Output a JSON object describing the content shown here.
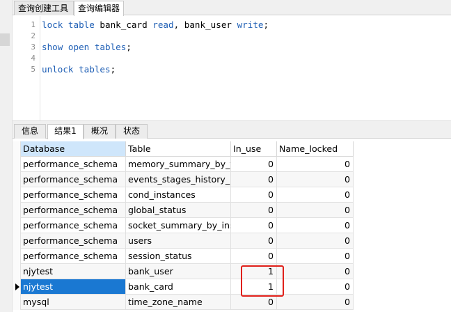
{
  "top_tabs": [
    "查询创建工具",
    "查询编辑器"
  ],
  "editor": {
    "lines": [
      {
        "n": "1",
        "tokens": [
          {
            "t": "lock table",
            "k": "kw"
          },
          {
            "t": " bank_card ",
            "k": "id"
          },
          {
            "t": "read",
            "k": "kw"
          },
          {
            "t": ", bank_user ",
            "k": "id"
          },
          {
            "t": "write",
            "k": "kw"
          },
          {
            "t": ";",
            "k": "id"
          }
        ]
      },
      {
        "n": "2",
        "tokens": []
      },
      {
        "n": "3",
        "tokens": [
          {
            "t": "show open tables",
            "k": "kw"
          },
          {
            "t": ";",
            "k": "id"
          }
        ]
      },
      {
        "n": "4",
        "tokens": []
      },
      {
        "n": "5",
        "tokens": [
          {
            "t": "unlock tables",
            "k": "kw"
          },
          {
            "t": ";",
            "k": "id"
          }
        ]
      }
    ]
  },
  "result_tabs": [
    "信息",
    "结果1",
    "概况",
    "状态"
  ],
  "grid": {
    "columns": [
      "Database",
      "Table",
      "In_use",
      "Name_locked"
    ],
    "rows": [
      [
        "performance_schema",
        "memory_summary_by_thre",
        "0",
        "0"
      ],
      [
        "performance_schema",
        "events_stages_history_lon",
        "0",
        "0"
      ],
      [
        "performance_schema",
        "cond_instances",
        "0",
        "0"
      ],
      [
        "performance_schema",
        "global_status",
        "0",
        "0"
      ],
      [
        "performance_schema",
        "socket_summary_by_insta",
        "0",
        "0"
      ],
      [
        "performance_schema",
        "users",
        "0",
        "0"
      ],
      [
        "performance_schema",
        "session_status",
        "0",
        "0"
      ],
      [
        "njytest",
        "bank_user",
        "1",
        "0"
      ],
      [
        "njytest",
        "bank_card",
        "1",
        "0"
      ],
      [
        "mysql",
        "time_zone_name",
        "0",
        "0"
      ]
    ],
    "selected_row": 8
  },
  "colors": {
    "keyword": "#1f5fb5",
    "selection": "#1a78d2",
    "highlight": "#e0201a"
  }
}
